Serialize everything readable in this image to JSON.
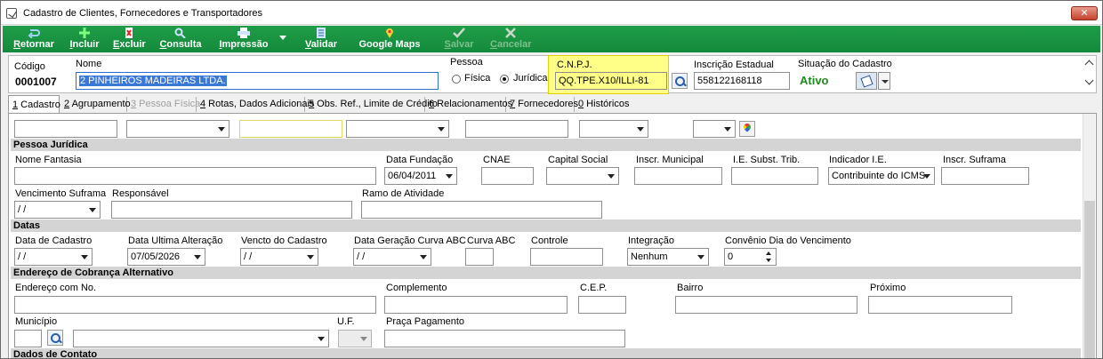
{
  "window": {
    "title": "Cadastro de Clientes, Fornecedores e Transportadores",
    "close_label": "✕"
  },
  "toolbar": {
    "buttons": [
      {
        "key": "R",
        "rest": "etornar",
        "icon": "return-arrow-icon",
        "enabled": true
      },
      {
        "key": "I",
        "rest": "ncluir",
        "icon": "plus-icon",
        "enabled": true
      },
      {
        "key": "E",
        "rest": "xcluir",
        "icon": "delete-icon",
        "enabled": true
      },
      {
        "key": "C",
        "rest": "onsulta",
        "icon": "search-icon",
        "enabled": true
      },
      {
        "key": "I",
        "rest": "mpressão",
        "icon": "printer-icon",
        "enabled": true
      },
      {
        "key": "V",
        "rest": "alidar",
        "icon": "validate-icon",
        "enabled": true
      },
      {
        "key": "",
        "rest": "Google Maps",
        "icon": "map-pin-icon",
        "enabled": true
      },
      {
        "key": "S",
        "rest": "alvar",
        "icon": "check-icon",
        "enabled": false
      },
      {
        "key": "C",
        "rest": "ancelar",
        "icon": "cancel-icon",
        "enabled": false
      }
    ]
  },
  "header": {
    "codigo_label": "Código",
    "codigo_value": "0001007",
    "nome_label": "Nome",
    "nome_value": "2 PINHEIROS MADEIRAS LTDA.",
    "pessoa_label": "Pessoa",
    "fisica_label": "Física",
    "juridica_label": "Jurídica",
    "pessoa_selected": "Jurídica",
    "cnpj_label": "C.N.P.J.",
    "cnpj_value": "QQ.TPE.X10/ILLI-81",
    "ie_label": "Inscrição Estadual",
    "ie_value": "558122168118",
    "situacao_label": "Situação do Cadastro",
    "situacao_value": "Ativo"
  },
  "tabs": [
    {
      "key": "1",
      "label": " Cadastro",
      "active": true,
      "disabled": false
    },
    {
      "key": "2",
      "label": " Agrupamento",
      "active": false,
      "disabled": false
    },
    {
      "key": "3",
      "label": " Pessoa Física",
      "active": false,
      "disabled": true
    },
    {
      "key": "4",
      "label": " Rotas, Dados Adicionais",
      "active": false,
      "disabled": false
    },
    {
      "key": "5",
      "label": " Obs. Ref., Limite de Crédito",
      "active": false,
      "disabled": false
    },
    {
      "key": "6",
      "label": " Relacionamentos",
      "active": false,
      "disabled": false
    },
    {
      "key": "7",
      "label": " Fornecedores",
      "active": false,
      "disabled": false
    },
    {
      "key": "0",
      "label": " Históricos",
      "active": false,
      "disabled": false
    }
  ],
  "sections": {
    "pessoa_juridica": "Pessoa Jurídica",
    "datas": "Datas",
    "endereco_cobranca": "Endereço de Cobrança Alternativo",
    "dados_contato": "Dados de Contato"
  },
  "pj": {
    "nome_fantasia_label": "Nome Fantasia",
    "data_fundacao_label": "Data Fundação",
    "data_fundacao_value": "06/04/2011",
    "cnae_label": "CNAE",
    "capital_social_label": "Capital Social",
    "inscr_municipal_label": "Inscr. Municipal",
    "ie_subst_label": "I.E. Subst. Trib.",
    "indicador_ie_label": "Indicador I.E.",
    "indicador_ie_value": "Contribuinte do ICMS",
    "inscr_suframa_label": "Inscr. Suframa",
    "venc_suframa_label": "Vencimento Suframa",
    "venc_suframa_value": " / /",
    "responsavel_label": "Responsável",
    "ramo_label": "Ramo de Atividade"
  },
  "datas": {
    "data_cadastro_label": "Data de Cadastro",
    "data_cadastro_value": " / /",
    "ultima_alteracao_label": "Data Ultima Alteração",
    "ultima_alteracao_value": "07/05/2026",
    "vencto_label": "Vencto do Cadastro",
    "vencto_value": " / /",
    "geracao_curva_label": "Data Geração Curva ABC",
    "geracao_curva_value": " / /",
    "curva_abc_label": "Curva ABC",
    "controle_label": "Controle",
    "integracao_label": "Integração",
    "integracao_value": "Nenhum",
    "convenio_label": "Convênio Dia do Vencimento",
    "convenio_value": "0"
  },
  "endereco": {
    "endereco_label": "Endereço com No.",
    "complemento_label": "Complemento",
    "cep_label": "C.E.P.",
    "bairro_label": "Bairro",
    "proximo_label": "Próximo",
    "municipio_label": "Município",
    "uf_label": "U.F.",
    "praca_label": "Praça Pagamento"
  }
}
